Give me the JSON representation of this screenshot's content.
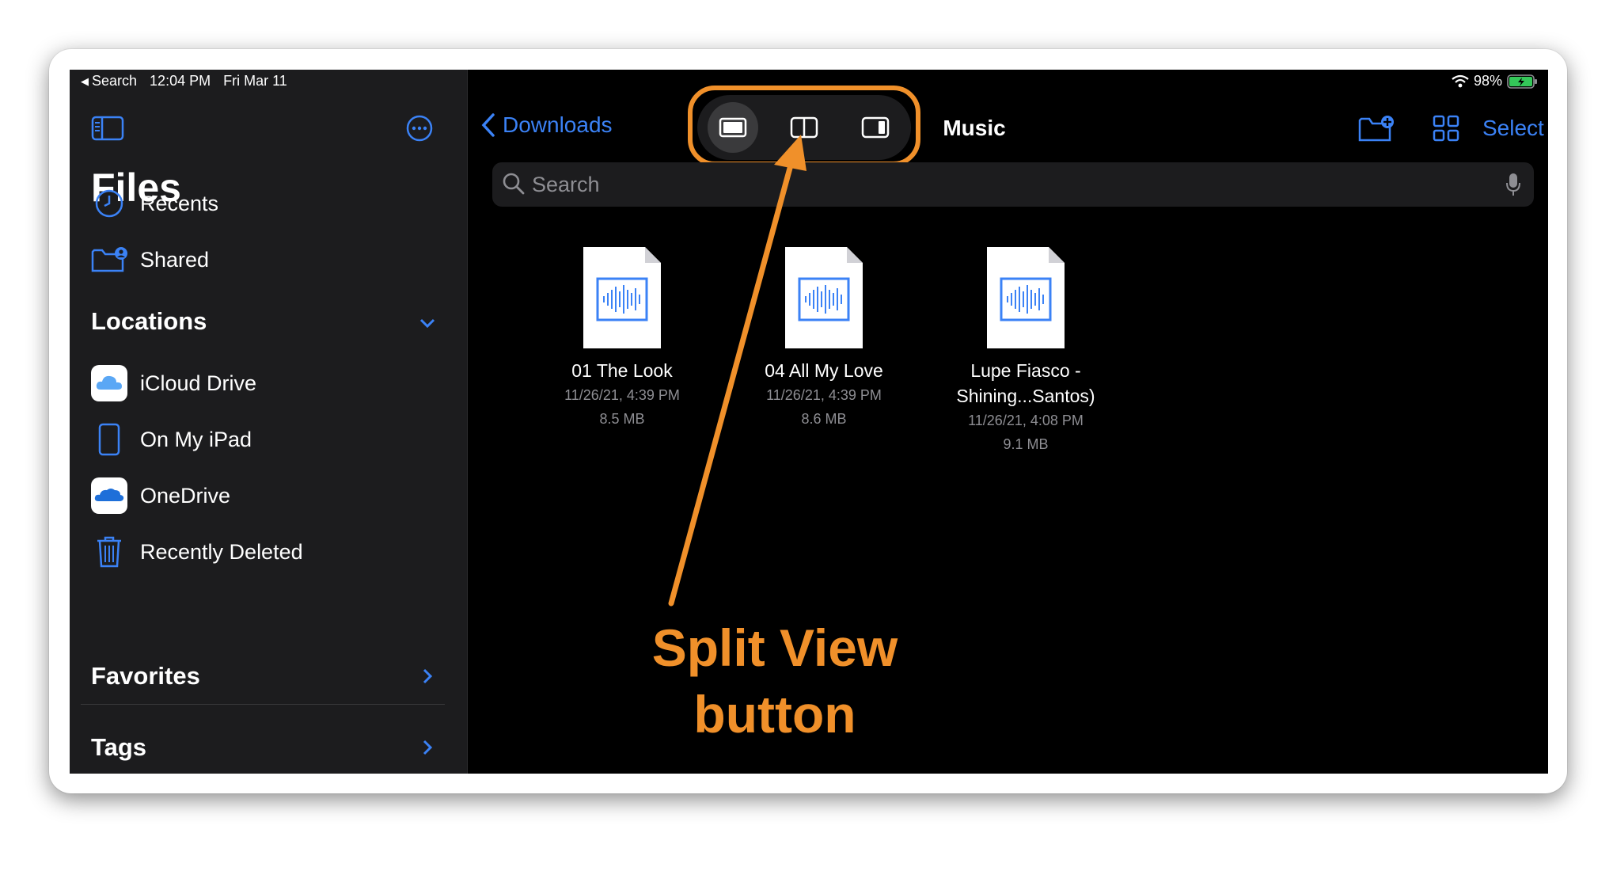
{
  "status": {
    "back_label": "Search",
    "time": "12:04 PM",
    "date": "Fri Mar 11",
    "battery": "98%"
  },
  "sidebar": {
    "title": "Files",
    "top_items": [
      {
        "label": "Recents",
        "icon": "clock-icon"
      },
      {
        "label": "Shared",
        "icon": "shared-folder-icon"
      }
    ],
    "locations": {
      "heading": "Locations",
      "items": [
        {
          "label": "iCloud Drive",
          "icon": "icloud-icon"
        },
        {
          "label": "On My iPad",
          "icon": "ipad-icon"
        },
        {
          "label": "OneDrive",
          "icon": "onedrive-icon"
        },
        {
          "label": "Recently Deleted",
          "icon": "trash-icon"
        }
      ]
    },
    "favorites": {
      "heading": "Favorites"
    },
    "tags": {
      "heading": "Tags"
    }
  },
  "nav": {
    "back_label": "Downloads",
    "title": "Music",
    "select_label": "Select"
  },
  "search": {
    "placeholder": "Search"
  },
  "files": [
    {
      "name": "01 The Look",
      "date": "11/26/21, 4:39 PM",
      "size": "8.5 MB"
    },
    {
      "name": "04 All My Love",
      "date": "11/26/21, 4:39 PM",
      "size": "8.6 MB"
    },
    {
      "name": "Lupe Fiasco - Shining...Santos)",
      "name_line1": "Lupe Fiasco -",
      "name_line2": "Shining...Santos)",
      "date": "11/26/21, 4:08 PM",
      "size": "9.1 MB"
    }
  ],
  "annotation": {
    "line1": "Split View",
    "line2": "button"
  },
  "colors": {
    "accent": "#3b82f6",
    "annotation": "#f0902a",
    "sidebar_bg": "#1c1c1e"
  }
}
